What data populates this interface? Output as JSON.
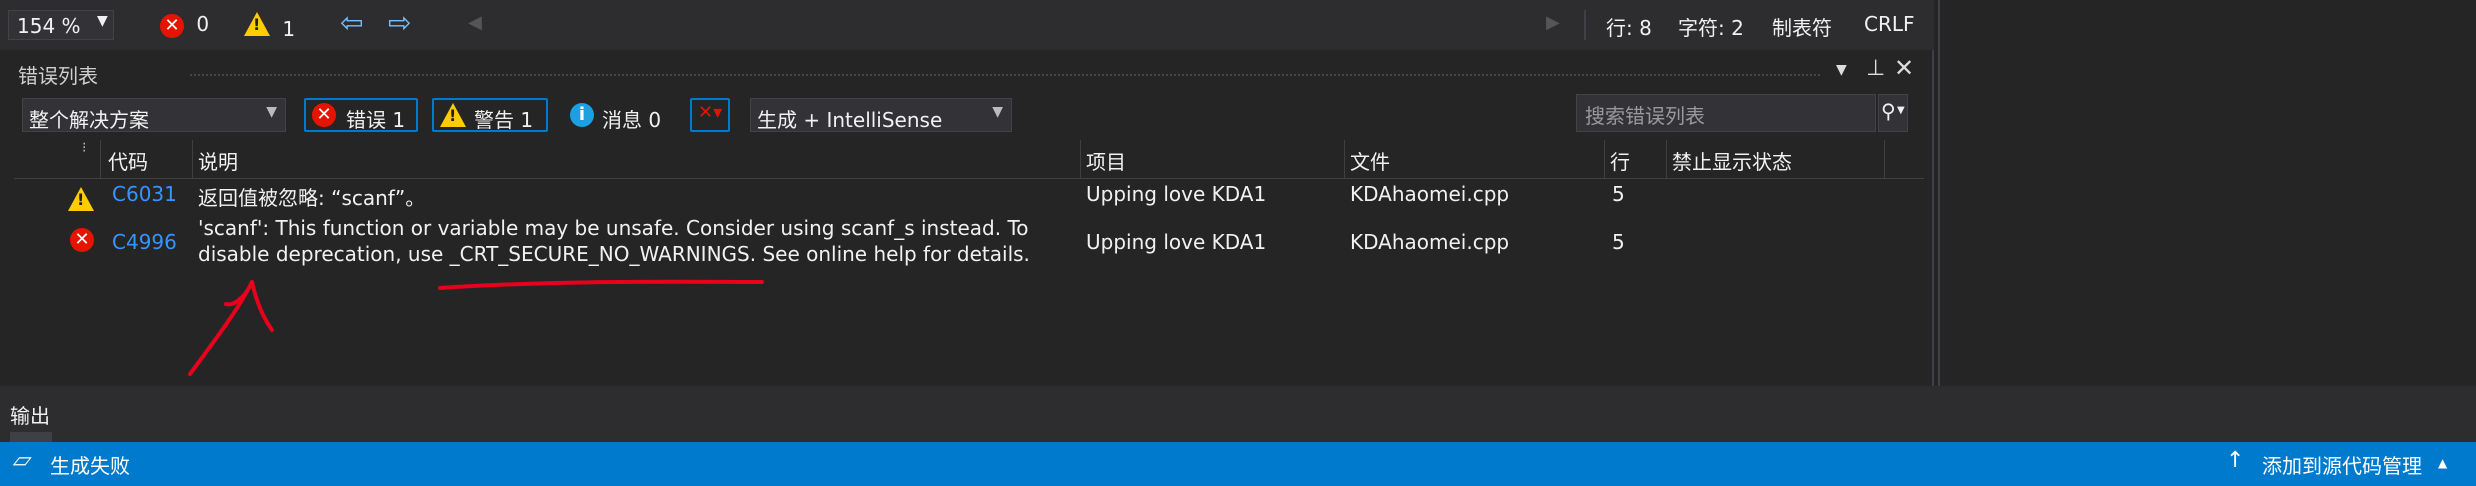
{
  "editor_bar": {
    "zoom": "154 %",
    "errors_count": "0",
    "warnings_count": "1",
    "line": "行: 8",
    "char": "字符: 2",
    "tab_mode": "制表符",
    "line_ending": "CRLF"
  },
  "error_list": {
    "title": "错误列表",
    "scope": "整个解决方案",
    "errors_button": "错误 1",
    "warnings_button": "警告 1",
    "messages_button": "消息 0",
    "build_filter": "生成 + IntelliSense",
    "search_placeholder": "搜索错误列表",
    "columns": [
      "代码",
      "说明",
      "项目",
      "文件",
      "行",
      "禁止显示状态"
    ],
    "rows": [
      {
        "severity": "warning",
        "code": "C6031",
        "description_line1": "返回值被忽略: “scanf”。",
        "description_line2": "",
        "project": "Upping love KDA1",
        "file": "KDAhaomei.cpp",
        "line": "5",
        "suppression": ""
      },
      {
        "severity": "error",
        "code": "C4996",
        "description_line1": "'scanf': This function or variable may be unsafe. Consider using scanf_s instead. To",
        "description_line2": "disable deprecation, use _CRT_SECURE_NO_WARNINGS. See online help for details.",
        "project": "Upping love KDA1",
        "file": "KDAhaomei.cpp",
        "line": "5",
        "suppression": ""
      }
    ]
  },
  "output_tab": {
    "label": "输出"
  },
  "status_bar": {
    "message": "生成失败",
    "source_control": "添加到源代码管理"
  },
  "colors": {
    "accent": "#007acc",
    "error": "#e51400",
    "warning": "#ffcc00",
    "link": "#3794ff",
    "annotation": "#e8001c"
  }
}
